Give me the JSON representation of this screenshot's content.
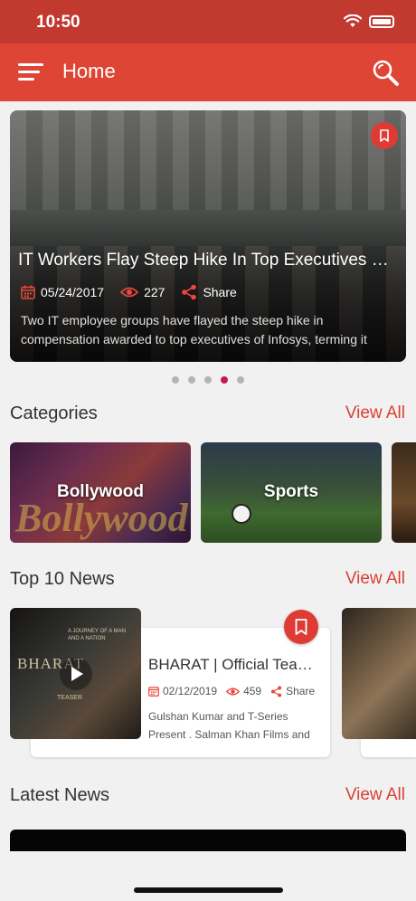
{
  "status_bar": {
    "time": "10:50"
  },
  "app_bar": {
    "title": "Home",
    "menu_icon": "hamburger-menu-icon",
    "search_icon": "search-icon"
  },
  "colors": {
    "app_bar": "#de4535",
    "status_bar": "#c2392f",
    "accent": "#d94035",
    "active_dot": "#c2185b"
  },
  "featured": {
    "title": "IT Workers Flay Steep Hike In Top Executives Salaries",
    "date": "05/24/2017",
    "views": "227",
    "share_label": "Share",
    "description": "Two IT employee groups have flayed the steep hike in compensation awarded to top executives of Infosys, terming it unjustified.",
    "pager": {
      "count": 5,
      "active_index": 3
    }
  },
  "categories": {
    "title": "Categories",
    "view_all": "View All",
    "items": [
      {
        "label": "Bollywood",
        "watermark": "Bollywood"
      },
      {
        "label": "Sports"
      }
    ]
  },
  "top_news": {
    "title": "Top 10 News",
    "view_all": "View All",
    "items": [
      {
        "title": "BHARAT | Official Teaser",
        "date": "02/12/2019",
        "views": "459",
        "share_label": "Share",
        "description": "Gulshan Kumar and T-Series Present . Salman Khan Films and Reel Life Productions",
        "thumb_text": "BHARAT",
        "thumb_small_1": "A JOURNEY OF A MAN",
        "thumb_small_2": "AND A NATION",
        "thumb_small_3": "TEASER"
      }
    ]
  },
  "latest_news": {
    "title": "Latest News",
    "view_all": "View All"
  }
}
